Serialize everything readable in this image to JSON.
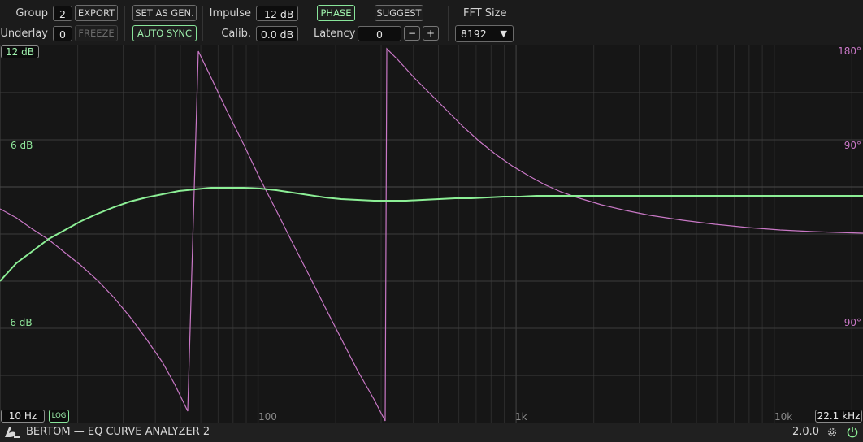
{
  "toolbar": {
    "group": {
      "label": "Group",
      "value": "2"
    },
    "underlay": {
      "label": "Underlay",
      "value": "0"
    },
    "export_label": "EXPORT",
    "freeze_label": "FREEZE",
    "set_as_gen_label": "SET AS GEN.",
    "auto_sync_label": "AUTO SYNC",
    "impulse": {
      "label": "Impulse",
      "value": "-12 dB"
    },
    "calib": {
      "label": "Calib.",
      "value": "0.0 dB"
    },
    "phase_label": "PHASE",
    "suggest_label": "SUGGEST",
    "latency": {
      "label": "Latency",
      "value": "0",
      "minus": "−",
      "plus": "+"
    },
    "fft": {
      "label": "FFT Size",
      "value": "8192"
    }
  },
  "plot": {
    "y_left_labels": {
      "top": "12 dB",
      "mid_high": "6 dB",
      "mid_low": "-6 dB"
    },
    "y_right_labels": {
      "top": "180°",
      "mid_high": "90°",
      "mid_low": "-90°"
    },
    "x_labels": {
      "a": "100",
      "b": "1k",
      "c": "10k"
    },
    "min_freq": "10 Hz",
    "log_label": "LOG",
    "max_freq": "22.1 kHz",
    "colors": {
      "magnitude": "#8cef96",
      "phase": "#c978c6",
      "grid_major": "#3c3c3c",
      "grid_minor": "#2c2c2c"
    }
  },
  "footer": {
    "logo_icon": "bertom-logo-icon",
    "title": "BERTOM — EQ CURVE ANALYZER 2",
    "version": "2.0.0",
    "settings_icon": "gear-icon",
    "power_icon": "power-icon"
  }
}
